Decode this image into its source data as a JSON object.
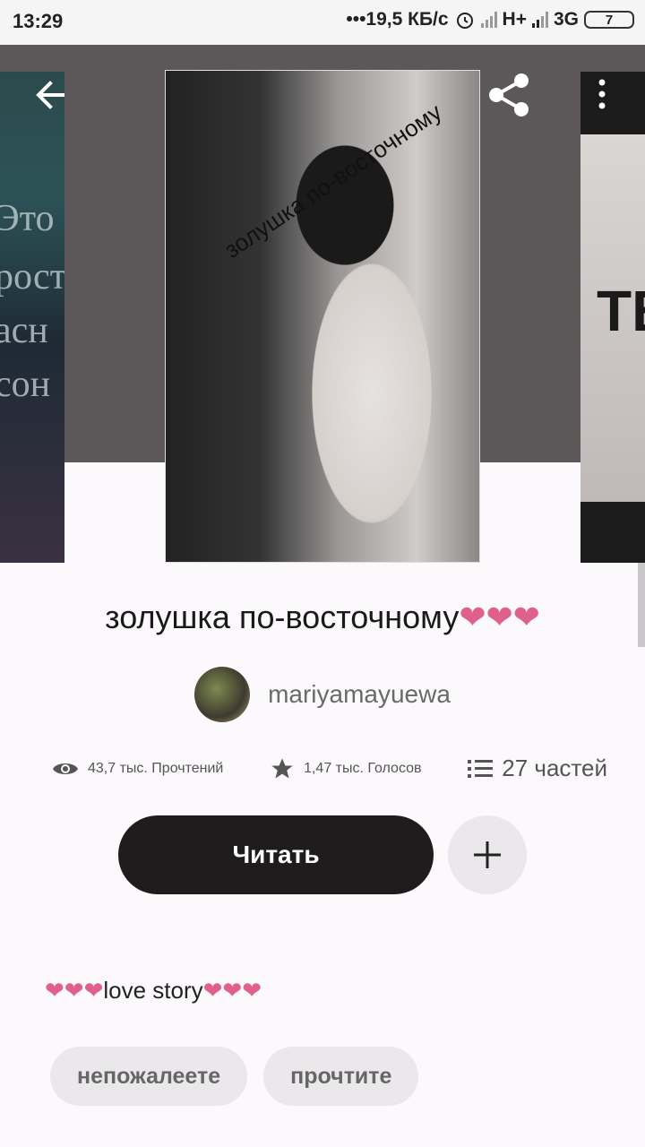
{
  "status_bar": {
    "time": "13:29",
    "speed": "•••19,5 КБ/с",
    "net1": "H+",
    "net2": "3G",
    "battery": "7"
  },
  "story": {
    "cover_caption": "золушка по-восточному",
    "title": "золушка по-восточному",
    "title_hearts": "❤❤❤",
    "author": "mariyamayuewa",
    "reads": "43,7 тыс. Прочтений",
    "votes": "1,47 тыс. Голосов",
    "parts": "27 частей",
    "description_prefix": "❤❤❤",
    "description_text": "love story",
    "description_suffix": "❤❤❤",
    "tags": [
      "непожалеете",
      "прочтите"
    ]
  },
  "actions": {
    "read_label": "Читать"
  },
  "side_covers": {
    "left_text": [
      "Это",
      "рост",
      "асн",
      "сон"
    ],
    "right_text": "ТВ"
  },
  "icons": {
    "back": "arrow-left-icon",
    "share": "share-icon",
    "menu": "more-vertical-icon",
    "reads": "eye-icon",
    "votes": "star-icon",
    "parts": "list-icon",
    "add": "plus-icon"
  },
  "colors": {
    "heart": "#e0608c",
    "read_button": "#1f1c1e"
  }
}
